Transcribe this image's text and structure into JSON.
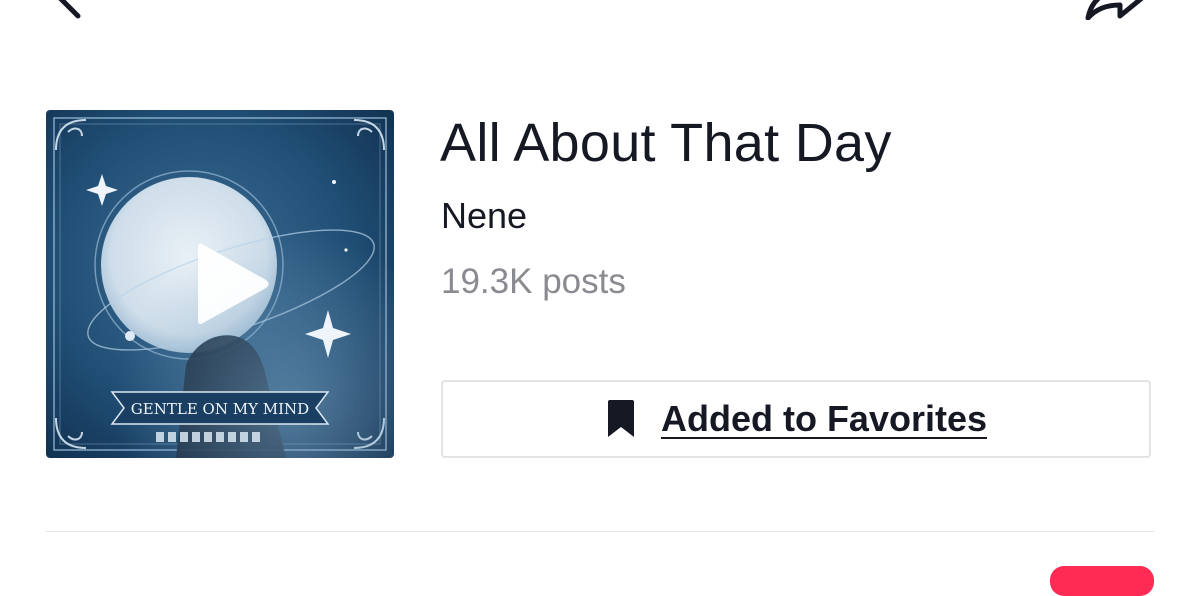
{
  "sound": {
    "title": "All About That Day",
    "artist": "Nene",
    "posts": "19.3K posts"
  },
  "favorite_button": {
    "label": "Added to Favorites",
    "icon": "bookmark-filled-icon"
  },
  "cover": {
    "play_icon": "play-icon",
    "artwork_text": "GENTLE ON MY MIND"
  },
  "header": {
    "back_icon": "chevron-left-icon",
    "share_icon": "share-arrow-icon"
  },
  "colors": {
    "text_primary": "#161823",
    "text_secondary": "#8a8b91",
    "accent": "#fe2c55",
    "border": "#e3e3e4"
  }
}
